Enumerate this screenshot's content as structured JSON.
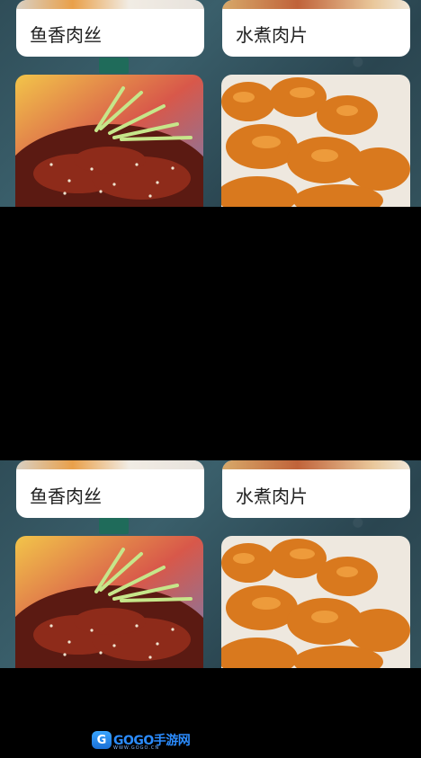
{
  "menu_top": {
    "row1": [
      {
        "label": "鱼香肉丝"
      },
      {
        "label": "水煮肉片"
      }
    ]
  },
  "menu_bottom": {
    "row1": [
      {
        "label": "鱼香肉丝"
      },
      {
        "label": "水煮肉片"
      }
    ]
  },
  "watermark": {
    "logo_glyph": "G",
    "text": "GOGO手游网",
    "sub": "WWW.GOGO.CN"
  }
}
